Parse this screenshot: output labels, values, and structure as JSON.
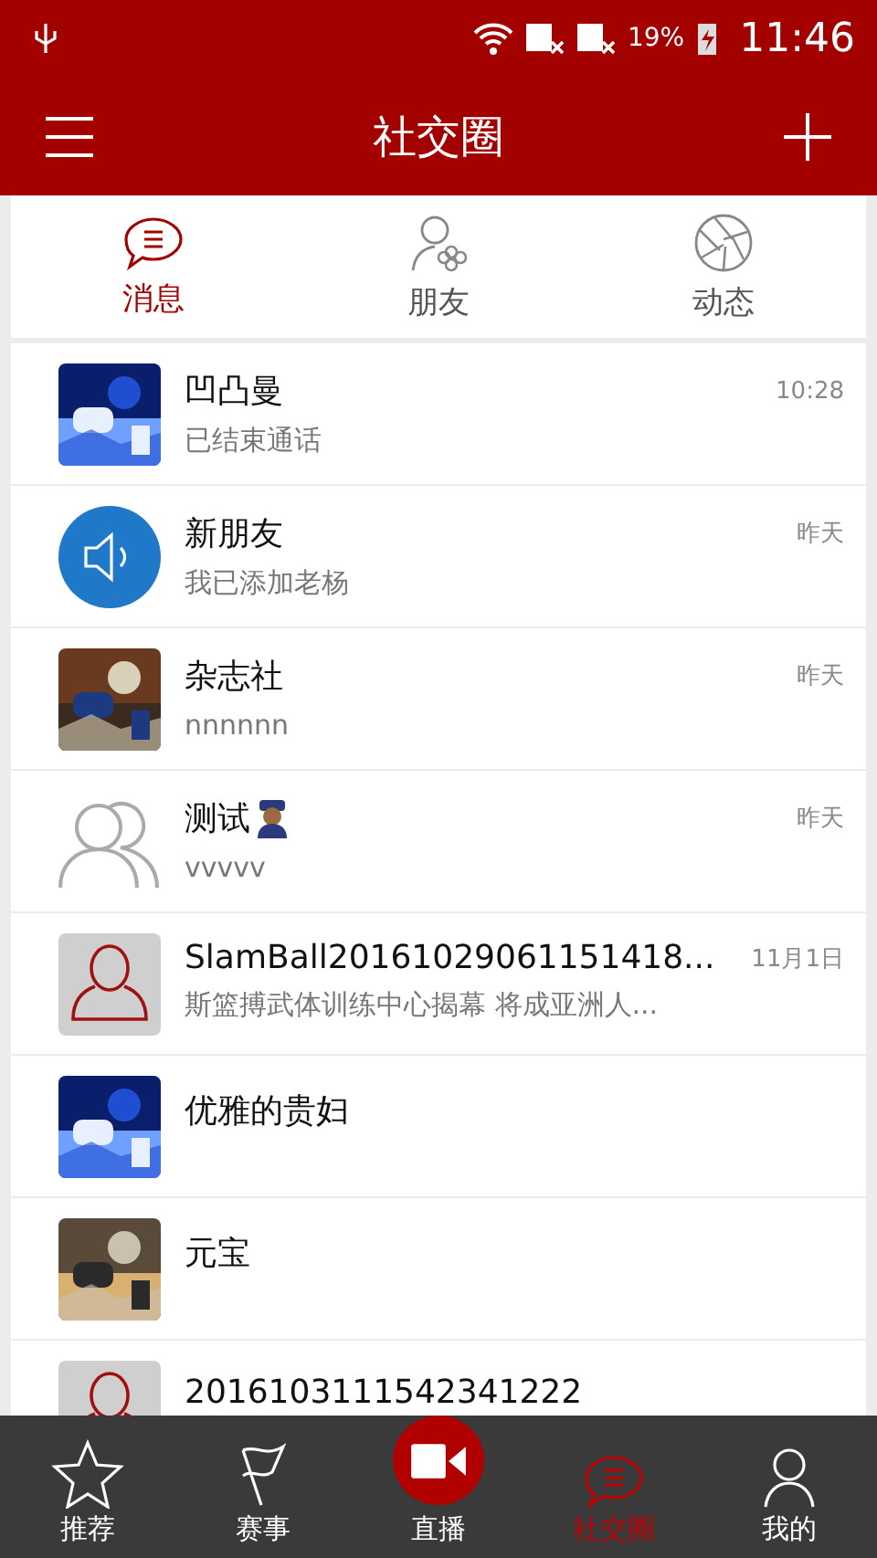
{
  "status_bar": {
    "battery": "19%",
    "time": "11:46"
  },
  "header": {
    "title": "社交圈"
  },
  "tabs": [
    {
      "label": "消息",
      "selected": true
    },
    {
      "label": "朋友",
      "selected": false
    },
    {
      "label": "动态",
      "selected": false
    }
  ],
  "conversations": [
    {
      "name": "凹凸曼",
      "preview": "已结束通话",
      "time": "10:28",
      "emoji_badge": false
    },
    {
      "name": "新朋友",
      "preview": "我已添加老杨",
      "time": "昨天",
      "avatar": {
        "kind": "speaker"
      },
      "emoji_badge": false
    },
    {
      "name": "杂志社",
      "preview": "nnnnnn",
      "time": "昨天",
      "emoji_badge": false
    },
    {
      "name": "测试",
      "preview": "vvvvv",
      "time": "昨天",
      "avatar": {
        "kind": "group"
      },
      "emoji_badge": true
    },
    {
      "name": "SlamBall20161029061151418...",
      "preview": "斯篮搏武体训练中心揭幕 将成亚洲人...",
      "time": "11月1日",
      "avatar": {
        "kind": "person"
      },
      "emoji_badge": false
    },
    {
      "name": "优雅的贵妇",
      "emoji_badge": false
    },
    {
      "name": "元宝",
      "emoji_badge": false
    },
    {
      "name": "2016103111542341222",
      "avatar": {
        "kind": "person"
      },
      "emoji_badge": false
    }
  ],
  "bottom_nav": [
    {
      "label": "推荐",
      "kind": "tab",
      "selected": false
    },
    {
      "label": "赛事",
      "kind": "tab",
      "selected": false
    },
    {
      "label": "直播",
      "kind": "live",
      "selected": false
    },
    {
      "label": "社交圈",
      "kind": "tab",
      "selected": true
    },
    {
      "label": "我的",
      "kind": "tab",
      "selected": false
    }
  ]
}
